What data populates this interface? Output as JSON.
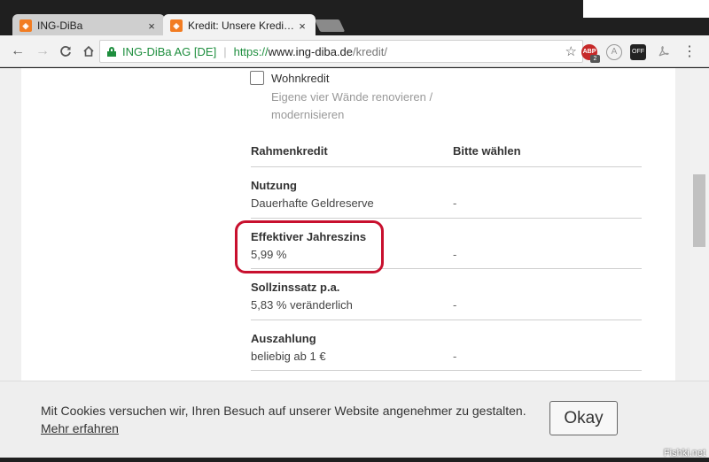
{
  "tabs": [
    {
      "title": "ING-DiBa",
      "close": "×"
    },
    {
      "title": "Kredit: Unsere Kredite un",
      "close": "×"
    }
  ],
  "toolbar": {
    "back": "←",
    "forward": "→",
    "reload": "C",
    "home": "⌂",
    "secure_label": "ING-DiBa AG [DE]",
    "divider": "|",
    "url_scheme": "https://",
    "url_host": "www.ing-diba.de",
    "url_path": "/kredit/",
    "star": "☆",
    "ext_abp_label": "ABP",
    "ext_abp_count": "2",
    "ext_a_label": "A",
    "ext_off_label": "OFF",
    "menu": "⋮"
  },
  "option": {
    "title": "Wohnkredit",
    "description": "Eigene vier Wände renovieren / modernisieren"
  },
  "table": {
    "header": [
      "Rahmenkredit",
      "Bitte wählen"
    ],
    "rows": [
      {
        "label": "Nutzung",
        "value": "Dauerhafte Geldreserve",
        "choice": "-"
      },
      {
        "label": "Effektiver Jahreszins",
        "value": "5,99 %",
        "choice": "-"
      },
      {
        "label": "Sollzinssatz p.a.",
        "value": "5,83 % veränderlich",
        "choice": "-"
      },
      {
        "label": "Auszahlung",
        "value": "beliebig ab 1 €",
        "choice": "-"
      }
    ]
  },
  "cookie": {
    "text": "Mit Cookies versuchen wir, Ihren Besuch auf unserer Website angenehmer zu gestalten.",
    "link": "Mehr erfahren",
    "button": "Okay"
  },
  "watermark": "Fishki.net",
  "colors": {
    "brand_orange": "#f27c22",
    "highlight_red": "#c8102e",
    "secure_green": "#1e8e3e"
  }
}
